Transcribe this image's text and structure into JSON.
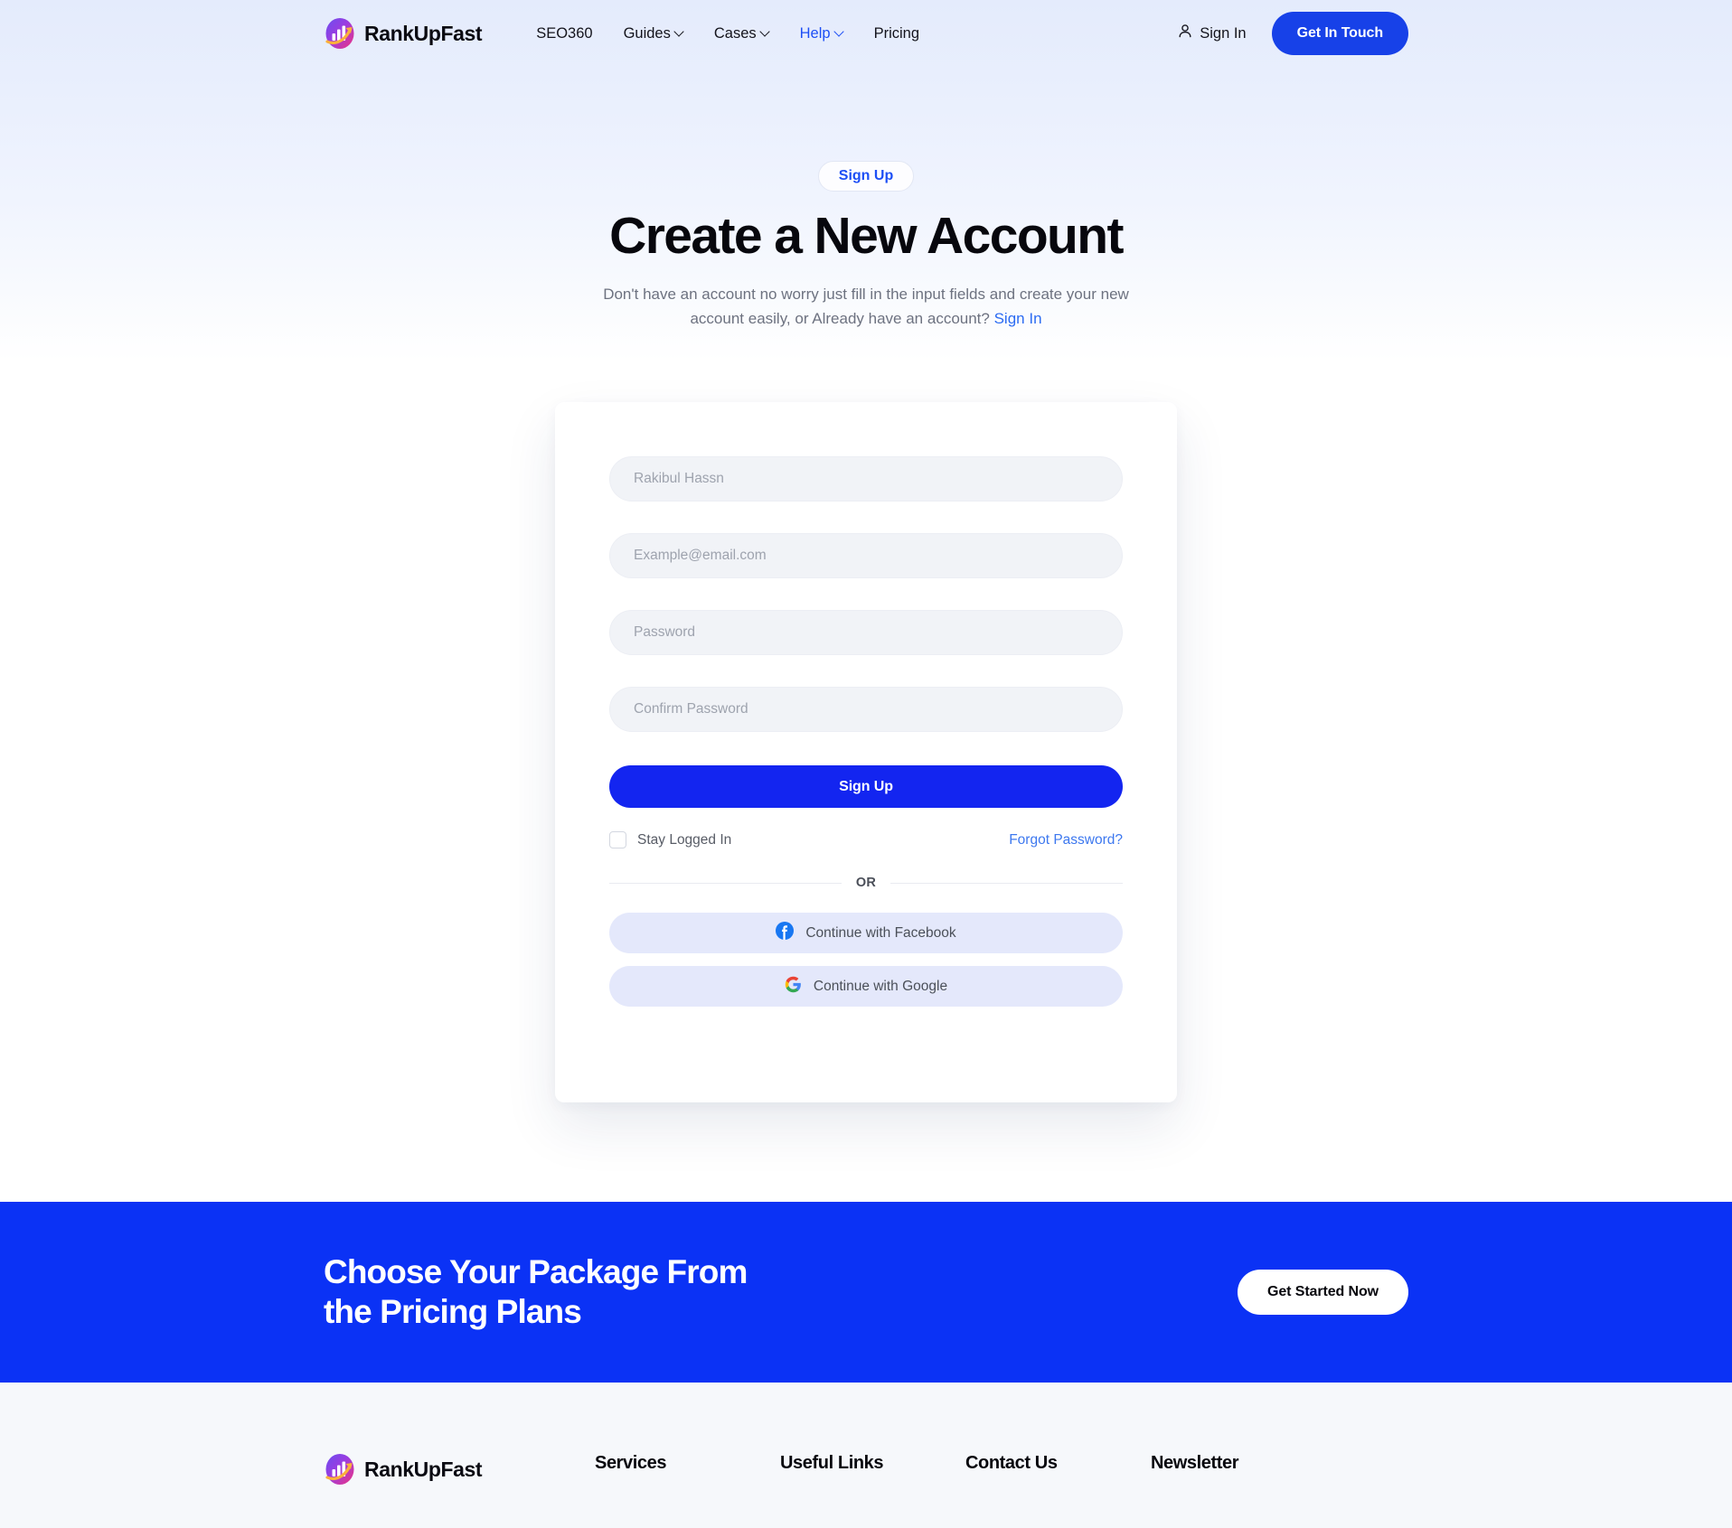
{
  "navbar": {
    "brand": {
      "name": "RankUpFast",
      "icon": "bar-chart-arrow-logo"
    },
    "links": [
      {
        "label": "SEO360",
        "has_chevron": false,
        "active": false
      },
      {
        "label": "Guides",
        "has_chevron": true,
        "active": false
      },
      {
        "label": "Cases",
        "has_chevron": true,
        "active": false
      },
      {
        "label": "Help",
        "has_chevron": true,
        "active": true
      },
      {
        "label": "Pricing",
        "has_chevron": false,
        "active": false
      }
    ],
    "sign_in": "Sign In",
    "cta_button": "Get In Touch"
  },
  "hero": {
    "badge": "Sign Up",
    "title": "Create a New Account",
    "subtitle_line1": "Don't have an account no worry just fill in the input fields and create your",
    "subtitle_line2": "new account easily, or Already have an account? ",
    "subtitle_link": "Sign In"
  },
  "form": {
    "fields": [
      {
        "name": "full-name",
        "placeholder": "Rakibul Hassn",
        "value": "",
        "type": "text"
      },
      {
        "name": "email",
        "placeholder": "Example@email.com",
        "value": "",
        "type": "email"
      },
      {
        "name": "password",
        "placeholder": "Password",
        "value": "",
        "type": "password"
      },
      {
        "name": "confirm-password",
        "placeholder": "Confirm Password",
        "value": "",
        "type": "password"
      }
    ],
    "submit_label": "Sign Up",
    "stay_logged_in": "Stay Logged In",
    "stay_logged_in_checked": false,
    "forgot_password": "Forgot Password?",
    "divider": "OR",
    "social": [
      {
        "label": "Continue with Facebook",
        "icon": "facebook-icon"
      },
      {
        "label": "Continue with Google",
        "icon": "google-icon"
      }
    ]
  },
  "cta": {
    "title_line1": "Choose Your Package From",
    "title_line2": "the Pricing Plans",
    "button": "Get Started Now"
  },
  "footer": {
    "brand": {
      "name": "RankUpFast",
      "icon": "bar-chart-arrow-logo"
    },
    "columns": [
      {
        "title": "Services"
      },
      {
        "title": "Useful Links"
      },
      {
        "title": "Contact Us"
      },
      {
        "title": "Newsletter"
      }
    ]
  },
  "colors": {
    "brand_blue": "#1741e8",
    "cta_blue": "#0b32f5",
    "signup_blue": "#1325f0",
    "link_blue": "#2b6bf2",
    "social_bg": "#e4e8fb",
    "field_bg": "#f1f3f7",
    "footer_bg": "#f6f8fb"
  }
}
